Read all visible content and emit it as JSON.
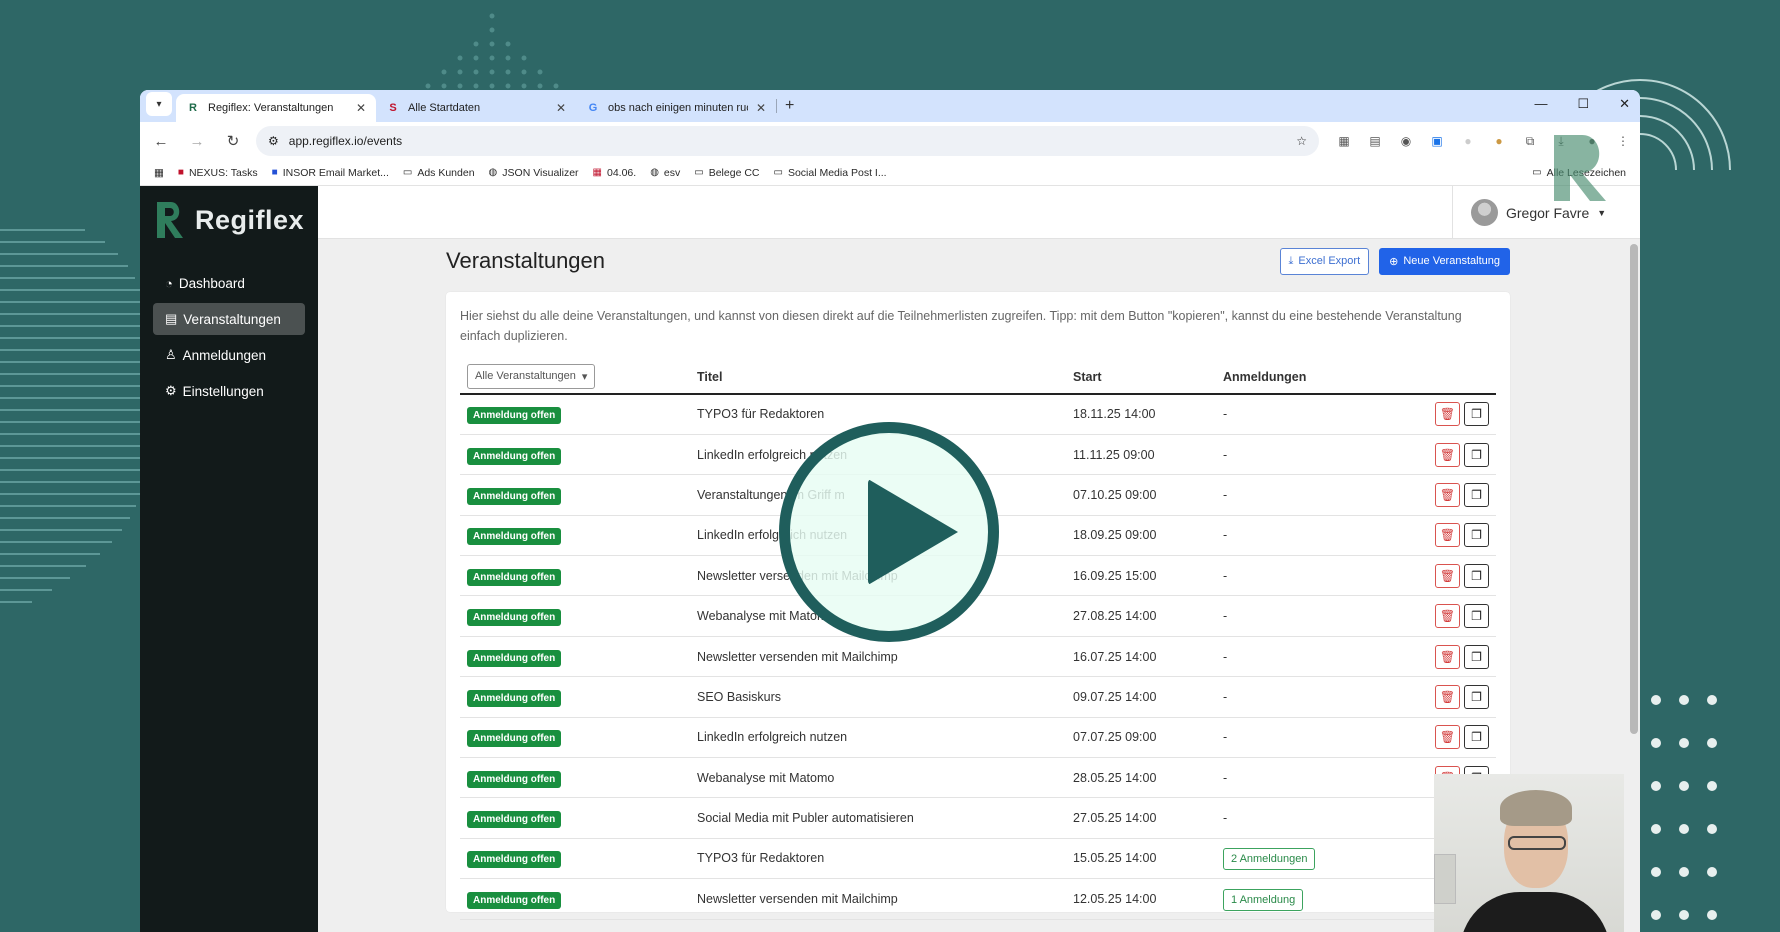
{
  "browser": {
    "tabs": [
      {
        "title": "Regiflex: Veranstaltungen",
        "favicon": "R",
        "active": true
      },
      {
        "title": "Alle Startdaten",
        "favicon": "S",
        "active": false
      },
      {
        "title": "obs nach einigen minuten ruck",
        "favicon": "G",
        "active": false
      }
    ],
    "url": "app.regiflex.io/events",
    "bookmarks": [
      {
        "label": "NEXUS: Tasks",
        "icon": "nexus-icon"
      },
      {
        "label": "INSOR Email Market...",
        "icon": "insor-icon"
      },
      {
        "label": "Ads Kunden",
        "icon": "folder-icon"
      },
      {
        "label": "JSON Visualizer",
        "icon": "globe-icon"
      },
      {
        "label": "04.06.",
        "icon": "calendar-icon"
      },
      {
        "label": "esv",
        "icon": "globe-icon"
      },
      {
        "label": "Belege CC",
        "icon": "folder-icon"
      },
      {
        "label": "Social Media Post I...",
        "icon": "folder-icon"
      }
    ],
    "bookmarks_right": "Alle Lesezeichen"
  },
  "app": {
    "brand": "Regiflex",
    "nav": [
      {
        "label": "Dashboard",
        "icon": "gauge-icon",
        "active": false
      },
      {
        "label": "Veranstaltungen",
        "icon": "calendar-icon",
        "active": true
      },
      {
        "label": "Anmeldungen",
        "icon": "user-icon",
        "active": false
      },
      {
        "label": "Einstellungen",
        "icon": "gear-icon",
        "active": false
      }
    ],
    "user": "Gregor Favre",
    "page_title": "Veranstaltungen",
    "excel_export": "Excel Export",
    "new_event": "Neue Veranstaltung",
    "intro": "Hier siehst du alle deine Veranstaltungen, und kannst von diesen direkt auf die Teilnehmerlisten zugreifen. Tipp: mit dem Button \"kopieren\", kannst du eine bestehende Veranstaltung einfach duplizieren.",
    "filter_label": "Alle Veranstaltungen",
    "columns": {
      "title": "Titel",
      "start": "Start",
      "registrations": "Anmeldungen"
    },
    "rows": [
      {
        "status": "Anmeldung offen",
        "title": "TYPO3 für Redaktoren",
        "start": "18.11.25 14:00",
        "registrations": "-"
      },
      {
        "status": "Anmeldung offen",
        "title": "LinkedIn erfolgreich nutzen",
        "start": "11.11.25 09:00",
        "registrations": "-"
      },
      {
        "status": "Anmeldung offen",
        "title": "Veranstaltungen im Griff m",
        "start": "07.10.25 09:00",
        "registrations": "-"
      },
      {
        "status": "Anmeldung offen",
        "title": "LinkedIn erfolgreich nutzen",
        "start": "18.09.25 09:00",
        "registrations": "-"
      },
      {
        "status": "Anmeldung offen",
        "title": "Newsletter versenden mit Mailchimp",
        "start": "16.09.25 15:00",
        "registrations": "-"
      },
      {
        "status": "Anmeldung offen",
        "title": "Webanalyse mit Matomo",
        "start": "27.08.25 14:00",
        "registrations": "-"
      },
      {
        "status": "Anmeldung offen",
        "title": "Newsletter versenden mit Mailchimp",
        "start": "16.07.25 14:00",
        "registrations": "-"
      },
      {
        "status": "Anmeldung offen",
        "title": "SEO Basiskurs",
        "start": "09.07.25 14:00",
        "registrations": "-"
      },
      {
        "status": "Anmeldung offen",
        "title": "LinkedIn erfolgreich nutzen",
        "start": "07.07.25 09:00",
        "registrations": "-"
      },
      {
        "status": "Anmeldung offen",
        "title": "Webanalyse mit Matomo",
        "start": "28.05.25 14:00",
        "registrations": "-"
      },
      {
        "status": "Anmeldung offen",
        "title": "Social Media mit Publer automatisieren",
        "start": "27.05.25 14:00",
        "registrations": "-"
      },
      {
        "status": "Anmeldung offen",
        "title": "TYPO3 für Redaktoren",
        "start": "15.05.25 14:00",
        "registrations": "2 Anmeldungen"
      },
      {
        "status": "Anmeldung offen",
        "title": "Newsletter versenden mit Mailchimp",
        "start": "12.05.25 14:00",
        "registrations": "1 Anmeldung"
      }
    ]
  },
  "colors": {
    "background": "#2e6766",
    "sidebar": "#121a1a",
    "primary": "#2163e8",
    "badge": "#198f3f",
    "delete": "#d9534f"
  }
}
